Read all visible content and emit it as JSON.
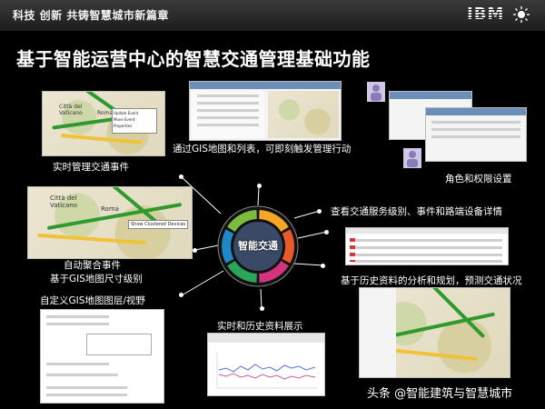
{
  "header": {
    "tagline": "科技 创新   共铸智慧城市新篇章",
    "logo": "IBM"
  },
  "title": "基于智能运营中心的智慧交通管理基础功能",
  "hub": {
    "label": "智能交通",
    "segment_colors": [
      "#f5a623",
      "#e85a2a",
      "#d6337f",
      "#2aa65a",
      "#1e88c8",
      "#7cbc3c"
    ]
  },
  "features": [
    {
      "id": "realtime_events",
      "label": "实时管理交通事件"
    },
    {
      "id": "gis_list",
      "label": "通过GIS地图和列表，可即刻触发管理行动"
    },
    {
      "id": "roles",
      "label": "角色和权限设置"
    },
    {
      "id": "service_levels",
      "label": "查看交通服务级别、事件和路端设备详情"
    },
    {
      "id": "auto_cluster",
      "label": "自动聚合事件"
    },
    {
      "id": "by_gis_size",
      "label": "基于GIS地图尺寸级别"
    },
    {
      "id": "history_analysis",
      "label": "基于历史资料的分析和规划，预测交通状况"
    },
    {
      "id": "custom_layers",
      "label": "自定义GIS地图图层/视野"
    },
    {
      "id": "realtime_history",
      "label": "实时和历史资料展示"
    }
  ],
  "thumb_texts": {
    "map1_city": "Città del Vaticano",
    "map1_roma": "Roma",
    "map1_menu": [
      "Update Event",
      "Move Event",
      "Properties"
    ],
    "map2_city": "Città del Vaticano",
    "map2_roma": "Roma",
    "map2_tooltip": "Show Clustered Devices"
  },
  "watermark": "头条 @智能建筑与智慧城市"
}
